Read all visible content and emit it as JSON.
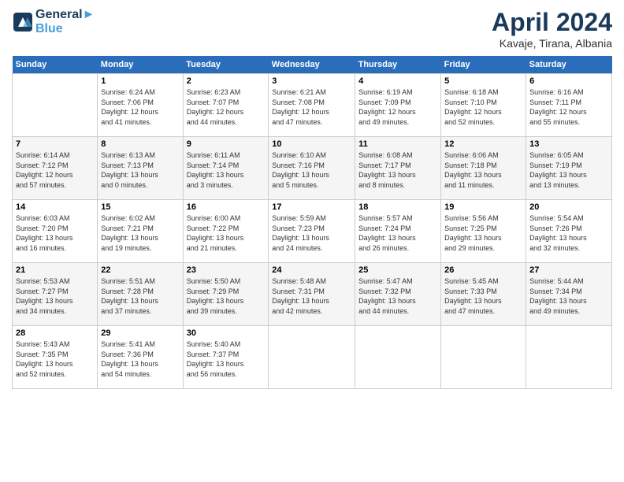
{
  "header": {
    "logo_line1": "General",
    "logo_line2": "Blue",
    "month": "April 2024",
    "location": "Kavaje, Tirana, Albania"
  },
  "calendar": {
    "days_of_week": [
      "Sunday",
      "Monday",
      "Tuesday",
      "Wednesday",
      "Thursday",
      "Friday",
      "Saturday"
    ],
    "weeks": [
      [
        {
          "day": "",
          "info": ""
        },
        {
          "day": "1",
          "info": "Sunrise: 6:24 AM\nSunset: 7:06 PM\nDaylight: 12 hours\nand 41 minutes."
        },
        {
          "day": "2",
          "info": "Sunrise: 6:23 AM\nSunset: 7:07 PM\nDaylight: 12 hours\nand 44 minutes."
        },
        {
          "day": "3",
          "info": "Sunrise: 6:21 AM\nSunset: 7:08 PM\nDaylight: 12 hours\nand 47 minutes."
        },
        {
          "day": "4",
          "info": "Sunrise: 6:19 AM\nSunset: 7:09 PM\nDaylight: 12 hours\nand 49 minutes."
        },
        {
          "day": "5",
          "info": "Sunrise: 6:18 AM\nSunset: 7:10 PM\nDaylight: 12 hours\nand 52 minutes."
        },
        {
          "day": "6",
          "info": "Sunrise: 6:16 AM\nSunset: 7:11 PM\nDaylight: 12 hours\nand 55 minutes."
        }
      ],
      [
        {
          "day": "7",
          "info": "Sunrise: 6:14 AM\nSunset: 7:12 PM\nDaylight: 12 hours\nand 57 minutes."
        },
        {
          "day": "8",
          "info": "Sunrise: 6:13 AM\nSunset: 7:13 PM\nDaylight: 13 hours\nand 0 minutes."
        },
        {
          "day": "9",
          "info": "Sunrise: 6:11 AM\nSunset: 7:14 PM\nDaylight: 13 hours\nand 3 minutes."
        },
        {
          "day": "10",
          "info": "Sunrise: 6:10 AM\nSunset: 7:16 PM\nDaylight: 13 hours\nand 5 minutes."
        },
        {
          "day": "11",
          "info": "Sunrise: 6:08 AM\nSunset: 7:17 PM\nDaylight: 13 hours\nand 8 minutes."
        },
        {
          "day": "12",
          "info": "Sunrise: 6:06 AM\nSunset: 7:18 PM\nDaylight: 13 hours\nand 11 minutes."
        },
        {
          "day": "13",
          "info": "Sunrise: 6:05 AM\nSunset: 7:19 PM\nDaylight: 13 hours\nand 13 minutes."
        }
      ],
      [
        {
          "day": "14",
          "info": "Sunrise: 6:03 AM\nSunset: 7:20 PM\nDaylight: 13 hours\nand 16 minutes."
        },
        {
          "day": "15",
          "info": "Sunrise: 6:02 AM\nSunset: 7:21 PM\nDaylight: 13 hours\nand 19 minutes."
        },
        {
          "day": "16",
          "info": "Sunrise: 6:00 AM\nSunset: 7:22 PM\nDaylight: 13 hours\nand 21 minutes."
        },
        {
          "day": "17",
          "info": "Sunrise: 5:59 AM\nSunset: 7:23 PM\nDaylight: 13 hours\nand 24 minutes."
        },
        {
          "day": "18",
          "info": "Sunrise: 5:57 AM\nSunset: 7:24 PM\nDaylight: 13 hours\nand 26 minutes."
        },
        {
          "day": "19",
          "info": "Sunrise: 5:56 AM\nSunset: 7:25 PM\nDaylight: 13 hours\nand 29 minutes."
        },
        {
          "day": "20",
          "info": "Sunrise: 5:54 AM\nSunset: 7:26 PM\nDaylight: 13 hours\nand 32 minutes."
        }
      ],
      [
        {
          "day": "21",
          "info": "Sunrise: 5:53 AM\nSunset: 7:27 PM\nDaylight: 13 hours\nand 34 minutes."
        },
        {
          "day": "22",
          "info": "Sunrise: 5:51 AM\nSunset: 7:28 PM\nDaylight: 13 hours\nand 37 minutes."
        },
        {
          "day": "23",
          "info": "Sunrise: 5:50 AM\nSunset: 7:29 PM\nDaylight: 13 hours\nand 39 minutes."
        },
        {
          "day": "24",
          "info": "Sunrise: 5:48 AM\nSunset: 7:31 PM\nDaylight: 13 hours\nand 42 minutes."
        },
        {
          "day": "25",
          "info": "Sunrise: 5:47 AM\nSunset: 7:32 PM\nDaylight: 13 hours\nand 44 minutes."
        },
        {
          "day": "26",
          "info": "Sunrise: 5:45 AM\nSunset: 7:33 PM\nDaylight: 13 hours\nand 47 minutes."
        },
        {
          "day": "27",
          "info": "Sunrise: 5:44 AM\nSunset: 7:34 PM\nDaylight: 13 hours\nand 49 minutes."
        }
      ],
      [
        {
          "day": "28",
          "info": "Sunrise: 5:43 AM\nSunset: 7:35 PM\nDaylight: 13 hours\nand 52 minutes."
        },
        {
          "day": "29",
          "info": "Sunrise: 5:41 AM\nSunset: 7:36 PM\nDaylight: 13 hours\nand 54 minutes."
        },
        {
          "day": "30",
          "info": "Sunrise: 5:40 AM\nSunset: 7:37 PM\nDaylight: 13 hours\nand 56 minutes."
        },
        {
          "day": "",
          "info": ""
        },
        {
          "day": "",
          "info": ""
        },
        {
          "day": "",
          "info": ""
        },
        {
          "day": "",
          "info": ""
        }
      ]
    ]
  }
}
